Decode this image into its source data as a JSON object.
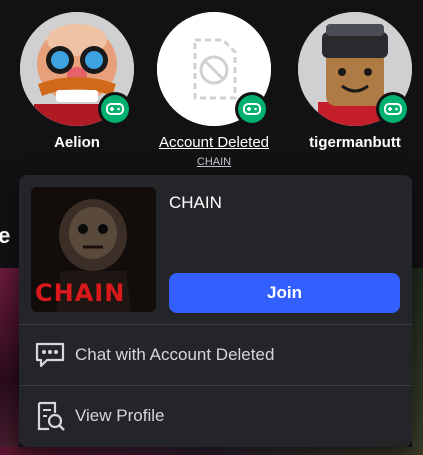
{
  "friends": [
    {
      "name": "Aelion",
      "sub": ""
    },
    {
      "name": "Account Deleted",
      "sub": "CHAIN"
    },
    {
      "name": "tigermanbutt",
      "sub": ""
    }
  ],
  "background": {
    "partial_heading": "le"
  },
  "popup": {
    "game_title": "CHAIN",
    "thumbnail_text": "CHAIN",
    "join_label": "Join",
    "chat_label": "Chat with Account Deleted",
    "profile_label": "View Profile"
  },
  "icons": {
    "presence": "gamepad-icon",
    "placeholder": "blocked-image-icon",
    "chat": "chat-bubble-icon",
    "profile": "profile-search-icon"
  },
  "colors": {
    "background": "#121215",
    "popup": "#232528",
    "accent_button": "#335fff",
    "presence_green": "#00b06f",
    "thumbnail_title": "#d8181a"
  }
}
